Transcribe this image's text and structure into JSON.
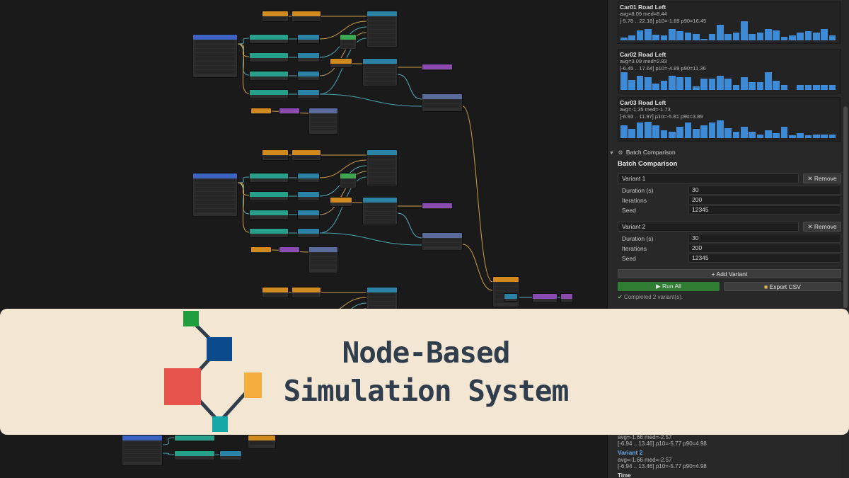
{
  "histograms": [
    {
      "title": "Car01 Road Left",
      "stat1": "avg=8.09  med=8.44",
      "stat2": "[-5.78 .. 22.18]  p10=-1.69  p90=16.45",
      "bars": [
        0.1,
        0.2,
        0.38,
        0.45,
        0.22,
        0.2,
        0.45,
        0.35,
        0.3,
        0.25,
        0.05,
        0.25,
        0.62,
        0.25,
        0.3,
        0.75,
        0.25,
        0.3,
        0.45,
        0.4,
        0.15,
        0.2,
        0.3,
        0.35,
        0.3,
        0.45,
        0.2
      ]
    },
    {
      "title": "Car02 Road Left",
      "stat1": "avg=3.09  med=2.83",
      "stat2": "[-6.45 .. 17.64]  p10=-4.89  p90=11.36",
      "bars": [
        0.7,
        0.4,
        0.55,
        0.5,
        0.25,
        0.35,
        0.55,
        0.5,
        0.5,
        0.15,
        0.45,
        0.45,
        0.55,
        0.45,
        0.2,
        0.5,
        0.3,
        0.3,
        0.7,
        0.35,
        0.2,
        0.0,
        0.2,
        0.2,
        0.2,
        0.2,
        0.2
      ]
    },
    {
      "title": "Car03 Road Left",
      "stat1": "avg=-1.35  med=-1.73",
      "stat2": "[-6.93 .. 11.97]  p10=-5.81  p90=3.89",
      "bars": [
        0.5,
        0.35,
        0.6,
        0.65,
        0.5,
        0.3,
        0.25,
        0.45,
        0.6,
        0.35,
        0.5,
        0.6,
        0.7,
        0.4,
        0.25,
        0.45,
        0.25,
        0.15,
        0.3,
        0.2,
        0.45,
        0.1,
        0.2,
        0.1,
        0.15,
        0.15,
        0.15
      ]
    }
  ],
  "batch": {
    "section_label": "Batch Comparison",
    "title": "Batch Comparison",
    "variants": [
      {
        "name": "Variant 1",
        "remove": "Remove",
        "duration_label": "Duration (s)",
        "duration": "30",
        "iterations_label": "Iterations",
        "iterations": "200",
        "seed_label": "Seed",
        "seed": "12345"
      },
      {
        "name": "Variant 2",
        "remove": "Remove",
        "duration_label": "Duration (s)",
        "duration": "30",
        "iterations_label": "Iterations",
        "iterations": "200",
        "seed_label": "Seed",
        "seed": "12345"
      }
    ],
    "add_variant": "+ Add Variant",
    "run_all": "Run All",
    "export_csv": "Export CSV",
    "status": "Completed 2 variant(s)."
  },
  "lower_panel": {
    "stat1a": "avg=-1.66  med=-2.57",
    "stat2a": "[-6.94 .. 13.46]  p10=-5.77  p90=4.98",
    "variant_label": "Variant 2",
    "stat1b": "avg=-1.66  med=-2.57",
    "stat2b": "[-6.94 .. 13.46]  p10=-5.77  p90=4.98",
    "time_label": "Time"
  },
  "banner": {
    "line1": "Node-Based",
    "line2": "Simulation System"
  },
  "colors": {
    "accent_blue": "#3d8bd6",
    "run_green": "#2e7d32",
    "logo_green": "#1e9e3c",
    "logo_navy": "#0b4a8b",
    "logo_red": "#e5534b",
    "logo_orange": "#f5ae3d",
    "logo_teal": "#16a7a7"
  }
}
